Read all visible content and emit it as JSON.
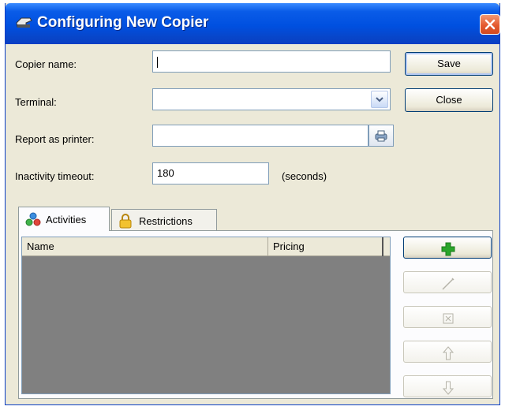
{
  "window": {
    "title": "Configuring New Copier"
  },
  "form": {
    "copier_name": {
      "label": "Copier name:",
      "value": ""
    },
    "terminal": {
      "label": "Terminal:",
      "value": ""
    },
    "report_as_printer": {
      "label": "Report as printer:",
      "value": ""
    },
    "inactivity_timeout": {
      "label": "Inactivity timeout:",
      "value": "180",
      "unit": "(seconds)"
    }
  },
  "buttons": {
    "save": "Save",
    "close": "Close"
  },
  "tabs": [
    {
      "label": "Activities",
      "icon": "activities-icon",
      "selected": true
    },
    {
      "label": "Restrictions",
      "icon": "lock-icon",
      "selected": false
    }
  ],
  "table": {
    "columns": [
      "Name",
      "Pricing"
    ],
    "rows": []
  },
  "side_actions": [
    {
      "icon": "add-icon",
      "enabled": true
    },
    {
      "icon": "edit-icon",
      "enabled": false
    },
    {
      "icon": "delete-icon",
      "enabled": false
    },
    {
      "icon": "move-up-icon",
      "enabled": false
    },
    {
      "icon": "move-down-icon",
      "enabled": false
    }
  ],
  "colors": {
    "title_bar": "#0050e0",
    "close_button": "#e45a2f",
    "add_green": "#2aa52a",
    "grid_background": "#808080"
  }
}
